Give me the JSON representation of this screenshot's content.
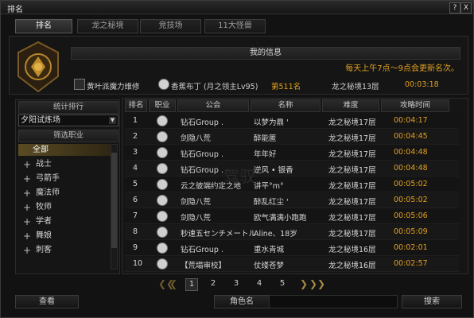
{
  "window": {
    "title": "排名",
    "controls": [
      "?",
      "X"
    ]
  },
  "tabs": [
    "排名",
    "龙之秘境",
    "竞技场",
    "11大怪兽"
  ],
  "my_info": {
    "title": "我的信息",
    "notice": "每天上午7点～9点会更新名次。",
    "guild": "黄叶派魔力维修",
    "name": "香蕉布丁 (月之领主Lv95)",
    "rank": "第511名",
    "difficulty": "龙之秘境13层",
    "time": "00:03:18"
  },
  "sidebar": {
    "stats_title": "统计排行",
    "selected": "夕阳试炼场",
    "filter_title": "筛选职业",
    "jobs": [
      "全部",
      "战士",
      "弓箭手",
      "魔法师",
      "牧师",
      "学者",
      "舞娘",
      "刺客"
    ]
  },
  "table": {
    "headers": [
      "排名",
      "职业",
      "公会",
      "名称",
      "难度",
      "攻略时间"
    ],
    "rows": [
      {
        "rank": "1",
        "guild": "钻石Group .",
        "name": "以梦为鼎 '",
        "difficulty": "龙之秘境17层",
        "time": "00:04:17"
      },
      {
        "rank": "2",
        "guild": "剑隐八荒",
        "name": "醉能匿",
        "difficulty": "龙之秘境17层",
        "time": "00:04:45"
      },
      {
        "rank": "3",
        "guild": "钻石Group .",
        "name": "年年好",
        "difficulty": "龙之秘境17层",
        "time": "00:04:48"
      },
      {
        "rank": "4",
        "guild": "钻石Group .",
        "name": "逆风 • 银香",
        "difficulty": "龙之秘境17层",
        "time": "00:04:48"
      },
      {
        "rank": "5",
        "guild": "云之彼端约定之地",
        "name": "讲平°m°",
        "difficulty": "龙之秘境17层",
        "time": "00:05:02"
      },
      {
        "rank": "6",
        "guild": "剑隐八荒",
        "name": "醉乱红尘 '",
        "difficulty": "龙之秘境17层",
        "time": "00:05:02"
      },
      {
        "rank": "7",
        "guild": "剑隐八荒",
        "name": "欧气满满小跑跑",
        "difficulty": "龙之秘境17层",
        "time": "00:05:06"
      },
      {
        "rank": "8",
        "guild": "秒速五センチメートル",
        "name": "Aline、18岁",
        "difficulty": "龙之秘境17层",
        "time": "00:05:09"
      },
      {
        "rank": "9",
        "guild": "钻石Group .",
        "name": "重水青城",
        "difficulty": "龙之秘境16层",
        "time": "00:02:01"
      },
      {
        "rank": "10",
        "guild": "【荒塌审校】",
        "name": "仗缕苍梦",
        "difficulty": "龙之秘境16层",
        "time": "00:02:57"
      }
    ]
  },
  "pagination": {
    "pages": [
      "1",
      "2",
      "3",
      "4",
      "5"
    ],
    "current": "1"
  },
  "bottom": {
    "view": "查看",
    "name_label": "角色名",
    "search": "搜索"
  },
  "watermark": "驾驭"
}
